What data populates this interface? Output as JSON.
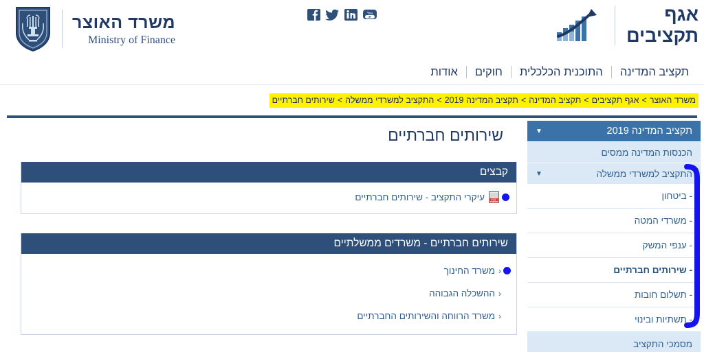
{
  "header": {
    "ministry_he": "משרד האוצר",
    "ministry_en": "Ministry of Finance",
    "budget_line1": "אגף",
    "budget_line2": "תקציבים",
    "social": [
      {
        "name": "youtube-icon",
        "label": "YouTube"
      },
      {
        "name": "linkedin-icon",
        "label": "LinkedIn"
      },
      {
        "name": "twitter-icon",
        "label": "Twitter"
      },
      {
        "name": "facebook-icon",
        "label": "Facebook"
      }
    ]
  },
  "nav": {
    "items": [
      {
        "label": "תקציב המדינה"
      },
      {
        "label": "התוכנית הכלכלית"
      },
      {
        "label": "חוקים"
      },
      {
        "label": "אודות"
      }
    ]
  },
  "breadcrumb": {
    "separator": ">",
    "highlight_color": "#fff200",
    "items": [
      {
        "label": "משרד האוצר"
      },
      {
        "label": "אגף תקציבים"
      },
      {
        "label": "תקציב המדינה"
      },
      {
        "label": "תקציב המדינה 2019"
      },
      {
        "label": "התקציב למשרדי ממשלה"
      },
      {
        "label": "שירותים חברתיים"
      }
    ]
  },
  "main": {
    "page_title": "שירותים חברתיים",
    "panels": [
      {
        "title": "קבצים",
        "type": "files",
        "rows": [
          {
            "label": "עיקרי התקציב - שירותים חברתיים",
            "icon": "pdf-icon",
            "cursor": true
          }
        ]
      },
      {
        "title": "שירותים חברתיים - משרדים ממשלתיים",
        "type": "links",
        "rows": [
          {
            "label": "משרד החינוך",
            "chevron": "‹",
            "cursor": true
          },
          {
            "label": "ההשכלה הגבוהה",
            "chevron": "‹",
            "cursor": false
          },
          {
            "label": "משרד הרווחה והשירותים החברתיים",
            "chevron": "‹",
            "cursor": false
          }
        ]
      }
    ]
  },
  "sidebar": {
    "header": {
      "label": "תקציב המדינה 2019",
      "caret": "▼"
    },
    "sub_top": {
      "label": "הכנסות המדינה ממסים"
    },
    "group": {
      "label": "התקציב למשרדי ממשלה",
      "caret": "▼"
    },
    "leaves": [
      {
        "label": "- ביטחון",
        "active": false
      },
      {
        "label": "- משרדי המטה",
        "active": false
      },
      {
        "label": "- ענפי המשק",
        "active": false
      },
      {
        "label": "- שירותים חברתיים",
        "active": true
      },
      {
        "label": "- תשלום חובות",
        "active": false
      },
      {
        "label": "- תשתיות ובינוי",
        "active": false
      }
    ],
    "bottom": {
      "label": "מסמכי התקציב"
    }
  },
  "annotation": {
    "type": "bracket",
    "color": "#1414f0"
  },
  "colors": {
    "navy": "#1f3864",
    "panel_header": "#2e4f7a",
    "sidebar_header": "#3b73a8",
    "sidebar_sub": "#dbe9f6",
    "link_blue": "#2f5f8f",
    "highlight": "#fff200",
    "annotation": "#1414f0"
  }
}
